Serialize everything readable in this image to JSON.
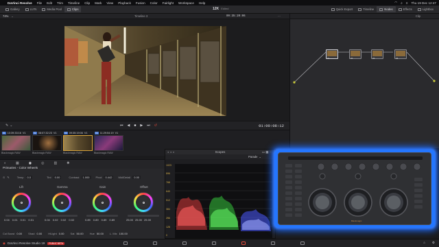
{
  "menubar": {
    "app": "DaVinci Resolve",
    "items": [
      "File",
      "Edit",
      "Trim",
      "Timeline",
      "Clip",
      "Mark",
      "View",
      "Playback",
      "Fusion",
      "Color",
      "Fairlight",
      "Workspace",
      "Help"
    ],
    "clock": "Thu 19 Dec 12:47"
  },
  "toolbar": {
    "gallery": "Gallery",
    "luts": "LUTs",
    "media_pool": "Media Pool",
    "clips": "Clips",
    "project_name": "12K",
    "project_state": "Edited",
    "quick_export": "Quick Export",
    "timeline": "Timeline",
    "nodes": "Nodes",
    "effects": "Effects",
    "lightbox": "Lightbox"
  },
  "viewer": {
    "zoom": "74%",
    "timeline_name": "Timeline 3",
    "source_tc": "09:35:20:06",
    "timecode": "01:00:08:12"
  },
  "node_editor": {
    "mode": "Clip",
    "nodes": [
      {
        "id": "01",
        "label": "01"
      },
      {
        "id": "02",
        "label": "02"
      },
      {
        "id": "03",
        "label": "03"
      },
      {
        "id": "04",
        "label": "04"
      }
    ]
  },
  "clips": [
    {
      "num": "01",
      "tc": "10:39:33:16",
      "track": "V1",
      "codec": "Blackmagic RAW"
    },
    {
      "num": "02",
      "tc": "08:07:32:23",
      "track": "V1",
      "codec": "Blackmagic RAW"
    },
    {
      "num": "03",
      "tc": "09:35:19:06",
      "track": "V1",
      "codec": "Blackmagic RAW"
    },
    {
      "num": "04",
      "tc": "11:29:54:19",
      "track": "V1",
      "codec": "Blackmagic RAW"
    }
  ],
  "color": {
    "title": "Primaries - Color Wheels",
    "temp_label": "Temp",
    "temp": "0.0",
    "tint_label": "Tint",
    "tint": "0.00",
    "contrast_label": "Contrast",
    "contrast": "1.000",
    "pivot_label": "Pivot",
    "pivot": "0.442",
    "middetail_label": "Mid/Detail",
    "middetail": "0.00",
    "wheels": [
      {
        "name": "Lift",
        "values": [
          "0.04",
          "0.01",
          "0.01",
          "0.01"
        ]
      },
      {
        "name": "Gamma",
        "values": [
          "0.04",
          "0.02",
          "0.02",
          "0.02"
        ]
      },
      {
        "name": "Gain",
        "values": [
          "0.89",
          "0.89",
          "0.89",
          "0.89"
        ]
      },
      {
        "name": "Offset",
        "values": [
          "25.00",
          "25.00",
          "25.00",
          "25.00"
        ]
      }
    ],
    "col_boost_label": "Col Boost",
    "col_boost": "0.00",
    "shad_label": "Shad",
    "shad": "0.00",
    "hilight_label": "HiLight",
    "hilight": "0.00",
    "sat_label": "Sat",
    "sat": "50.00",
    "hue_label": "Hue",
    "hue": "50.00",
    "lmix_label": "L. Mix",
    "lmix": "100.00"
  },
  "scopes": {
    "title": "Scopes",
    "mode": "Parade",
    "scale": [
      "1023",
      "896",
      "768",
      "640",
      "512",
      "384",
      "256",
      "128",
      "0"
    ]
  },
  "bottombar": {
    "app": "DaVinci Resolve Studio 19",
    "badge": "PUBLIC BETA"
  },
  "panel": {
    "brand": "Blackmagic"
  }
}
